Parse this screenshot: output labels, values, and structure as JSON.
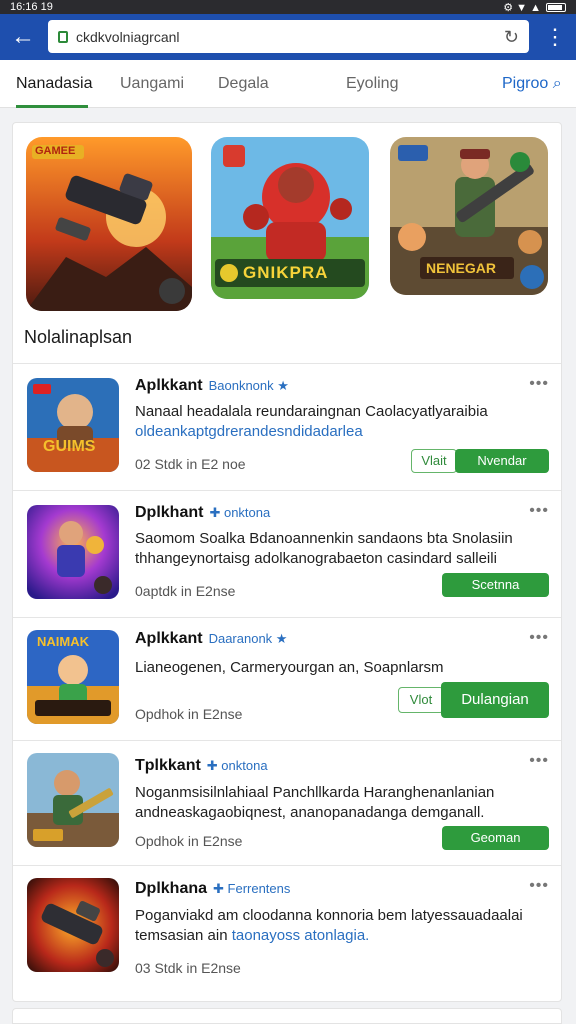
{
  "status": {
    "time": "16:16 19",
    "icons": "⚙ ▼ ▲"
  },
  "browser": {
    "url": "ckdkvolniagrcanl"
  },
  "tabs": [
    {
      "label": "Nanadasia"
    },
    {
      "label": "Uangami"
    },
    {
      "label": "Degala"
    },
    {
      "label": "Eyoling"
    },
    {
      "label": "Pigroo"
    }
  ],
  "featured": [
    {
      "badge": "GAMEE",
      "caption": ""
    },
    {
      "badge": "",
      "caption": "GNIKPRA"
    },
    {
      "badge": "",
      "caption": "NENEGAR"
    }
  ],
  "section_title": "Nolalinaplsan",
  "items": [
    {
      "thumb_caption": "GUIMS",
      "title": "Aplkkant",
      "tag": "Baonknonk ★",
      "desc": "Nanaal headalala reundaraingnan Caolacyatlyaraibia",
      "desc_highlight": "oldeankaptgdrerandesndidadarlea",
      "meta": "02 Stdk in E2 noe",
      "ghost_label": "Vlait",
      "solid_label": "Nvendar"
    },
    {
      "thumb_caption": "",
      "title": "Dplkhant",
      "tag": "✚ onktona",
      "desc": "Saomom Soalka Bdanoannenkin sandaons bta Snolasiin thhangeynortaisg adolkanograbaeton casindard salleili",
      "desc_highlight": "",
      "meta": "0aptdk in E2nse",
      "ghost_label": "",
      "solid_label": "Scetnna"
    },
    {
      "thumb_caption": "NAIMAK",
      "title": "Aplkkant",
      "tag": "Daaranonk ★",
      "desc": "Lianeogenen, Carmeryourgan an, Soapnlarsm",
      "desc_highlight": "",
      "meta": "Opdhok in E2nse",
      "ghost_label": "Vlot",
      "solid_label": "Dulangian"
    },
    {
      "thumb_caption": "",
      "title": "Tplkkant",
      "tag": "✚ onktona",
      "desc": "Noganmsisilnlahiaal Panchllkarda Haranghenanlanian andneaskagaobiqnest, ananopanadanga demganall.",
      "desc_highlight": "",
      "meta": "Opdhok in E2nse",
      "ghost_label": "",
      "solid_label": "Geoman"
    },
    {
      "thumb_caption": "",
      "title": "Dplkhana",
      "tag": "✚ Ferrentens",
      "desc": "Poganviakd am cloodanna konnoria bem latyessauadaalai temsasian ain",
      "desc_highlight": "taonayoss atonlagia.",
      "meta": "03 Stdk in E2nse",
      "ghost_label": "",
      "solid_label": ""
    }
  ],
  "colors": {
    "appbar": "#1e4fae",
    "accent_green": "#2e9b3d",
    "link_blue": "#2a6fc0"
  }
}
